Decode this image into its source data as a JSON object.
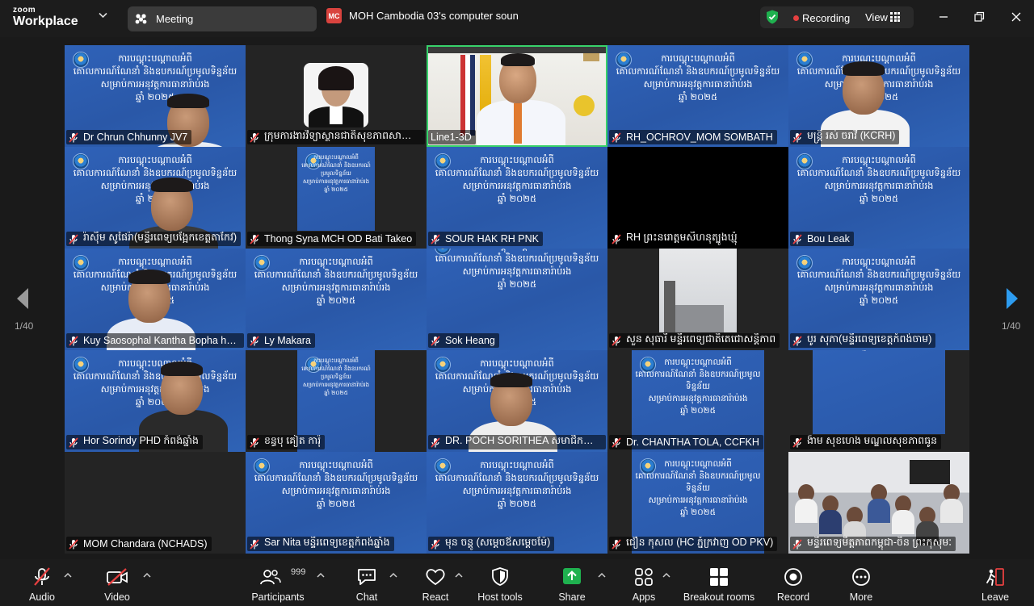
{
  "app": {
    "logo_line1": "zoom",
    "logo_line2": "Workplace"
  },
  "tabs": {
    "meeting": "Meeting",
    "share_badge": "MC",
    "share_title": "MOH Cambodia 03's computer soun"
  },
  "status": {
    "recording": "Recording",
    "view": "View"
  },
  "slide_text": [
    "ការបណ្តុះបណ្តាលអំពី",
    "គោលការណ៍ណែនាំ និងឧបករណ៍ប្រមូលទិន្នន័យ",
    "សម្រាប់ការអនុវត្តការធានារ៉ាប់រង",
    "ឆ្នាំ ២០២៥"
  ],
  "participants": [
    {
      "name": "Dr Chrun Chhunny JV7"
    },
    {
      "name": "ក្រុមការងារវិទ្យាស្ថានជាតិសុខភាពសាធារណៈ"
    },
    {
      "name": "Line1-3D"
    },
    {
      "name": "RH_OCHROV_MOM SOMBATH"
    },
    {
      "name": "មន្ត្រី រស់ ចរាវី (KCRH)"
    },
    {
      "name": "រ៉ាស៊ីម សូផៃរ៉ា(មន្ទីរពេទ្យបង្អែកខេត្តតាកែវ)"
    },
    {
      "name": "Thong Syna  MCH OD Bati Takeo"
    },
    {
      "name": "SOUR HAK RH PNK"
    },
    {
      "name": "RH ព្រះនរោត្តមសីហនុត្បូងឃ្មុំ"
    },
    {
      "name": "Bou Leak"
    },
    {
      "name": "Kuy Saosophal Kantha Bopha hospital"
    },
    {
      "name": "Ly Makara"
    },
    {
      "name": "Sok Heang"
    },
    {
      "name": "សួន សុធារី មន្ទីរពេទ្យជាតិតេជោសន្តិភាព"
    },
    {
      "name": "បូរ សុភា(មន្ទីរពេទ្យខេត្តកំពង់ចាម)"
    },
    {
      "name": "Hor Sorindy PHD កំពង់ឆ្នាំង"
    },
    {
      "name": "ខន្ធបុ គៀត ការ៉ុ"
    },
    {
      "name": "DR. POCH SORITHEA  សមាជិកក្រុមការងារ"
    },
    {
      "name": "Dr. CHANTHA TOLA, CCFKH"
    },
    {
      "name": "ង៉ាម សុខហេង មណ្ឌលសុខភាពធូន"
    },
    {
      "name": "MOM Chandara (NCHADS)"
    },
    {
      "name": "Sar Nita មន្ទីរពេទ្យខេត្តកំពង់ឆ្នាំង"
    },
    {
      "name": "មុន ចន្តូ (សម្តេចឪសម្តេចម៉ែ)"
    },
    {
      "name": "ជឿន កុសល (HC ភ្នំក្រវាញ OD PKV)"
    },
    {
      "name": "មន្ទីរពេទ្យមិត្តភាពកម្ពុជា-ចិន ព្រះកុសុមៈ"
    }
  ],
  "pagination": {
    "left": "1/40",
    "right": "1/40"
  },
  "toolbar": {
    "audio": "Audio",
    "video": "Video",
    "participants": "Participants",
    "participant_count": "999",
    "chat": "Chat",
    "react": "React",
    "host_tools": "Host tools",
    "share": "Share",
    "apps": "Apps",
    "breakout": "Breakout rooms",
    "record": "Record",
    "more": "More",
    "leave": "Leave"
  },
  "colors": {
    "accent_green": "#1fb14f",
    "active_border": "#38d26b",
    "record_red": "#e64040",
    "slide_blue": "#2f62b8"
  }
}
